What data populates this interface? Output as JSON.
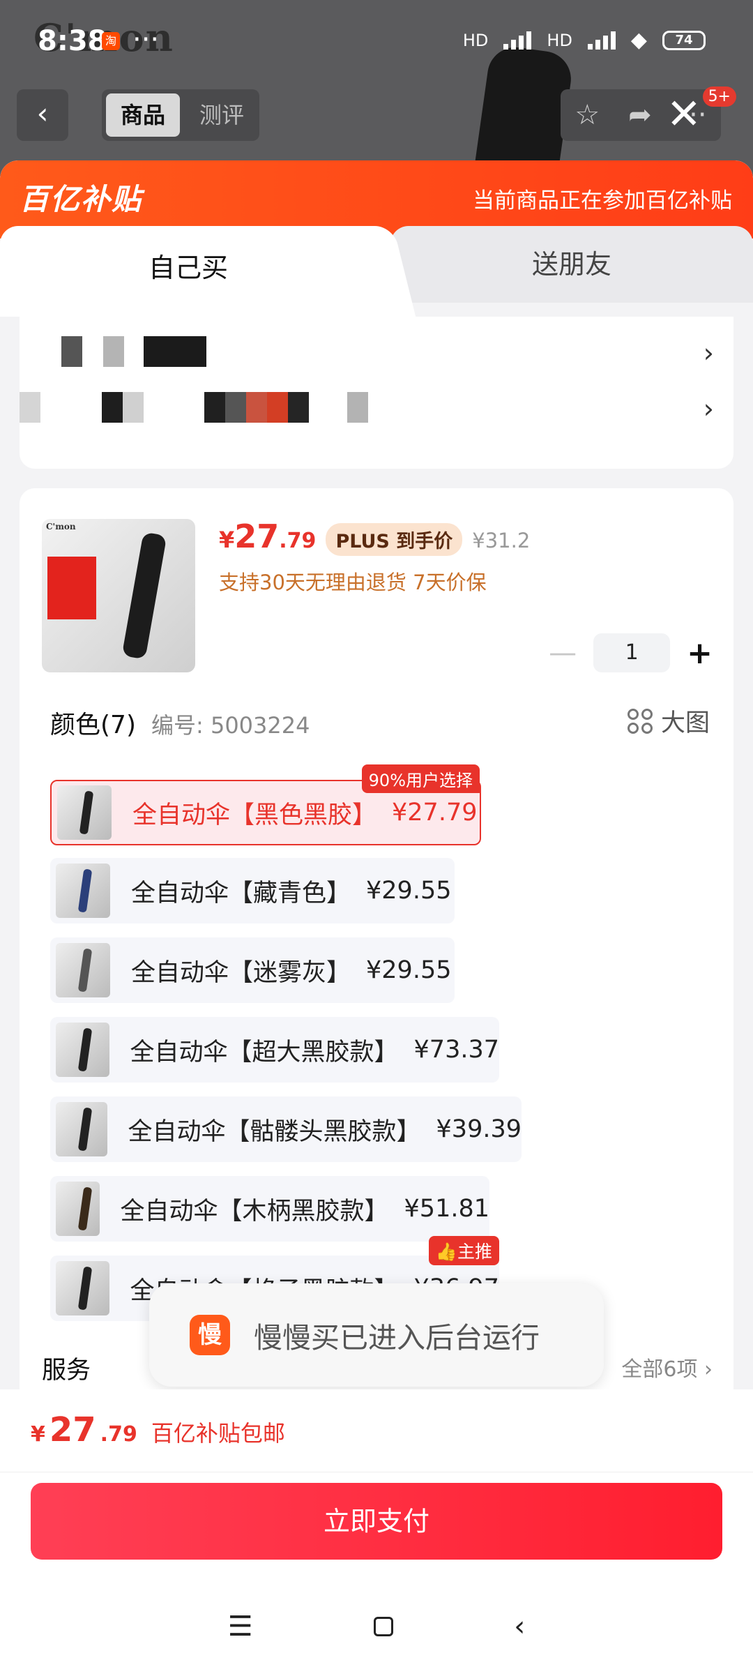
{
  "status_bar": {
    "time": "8:38",
    "app_badge": "淘",
    "dots": "···",
    "network1": "HD",
    "network2": "HD",
    "battery": "74"
  },
  "background": {
    "brand_logo": "C'mon"
  },
  "nav": {
    "back_icon": "chevron-left-icon",
    "tab_product": "商品",
    "tab_review": "测评",
    "star_icon": "☆",
    "share_icon": "➦",
    "more_icon": "···",
    "badge": "5+",
    "close": "✕"
  },
  "banner": {
    "brand": "百亿补贴",
    "note": "当前商品正在参加百亿补贴"
  },
  "tabs": {
    "self": "自己买",
    "gift": "送朋友"
  },
  "product": {
    "thumb_brand": "C'mon",
    "currency": "¥",
    "price_int": "27",
    "price_dec": ".79",
    "plus_tag": "PLUS 到手价",
    "original_price": "¥31.2",
    "policy": "支持30天无理由退货 7天价保",
    "qty_minus": "—",
    "qty": "1",
    "qty_plus": "+"
  },
  "color_section": {
    "title": "颜色(7)",
    "code": "编号: 5003224",
    "big_image": "大图",
    "options": [
      {
        "text": "全自动伞【黑色黑胶】",
        "price": "¥27.79",
        "tag": "90%用户选择"
      },
      {
        "text": "全自动伞【藏青色】",
        "price": "¥29.55"
      },
      {
        "text": "全自动伞【迷雾灰】",
        "price": "¥29.55"
      },
      {
        "text": "全自动伞【超大黑胶款】",
        "price": "¥73.37"
      },
      {
        "text": "全自动伞【骷髅头黑胶款】",
        "price": "¥39.39"
      },
      {
        "text": "全自动伞【木柄黑胶款】",
        "price": "¥51.81"
      },
      {
        "text": "全自动伞【格子黑胶款】",
        "price": "¥36.97",
        "tag": "主推"
      }
    ]
  },
  "service": {
    "title": "服务",
    "all": "全部6项 ›"
  },
  "toast": {
    "icon_char": "慢",
    "message": "慢慢买已进入后台运行"
  },
  "footer": {
    "currency": "¥",
    "price_int": "27",
    "price_dec": ".79",
    "shipping": "百亿补贴包邮",
    "pay_button": "立即支付"
  },
  "system_nav": {
    "menu": "☰",
    "back": "‹"
  },
  "colors": {
    "accent_red": "#e8332b",
    "banner_orange": "#ff5a1a",
    "policy_orange": "#c8702a"
  }
}
